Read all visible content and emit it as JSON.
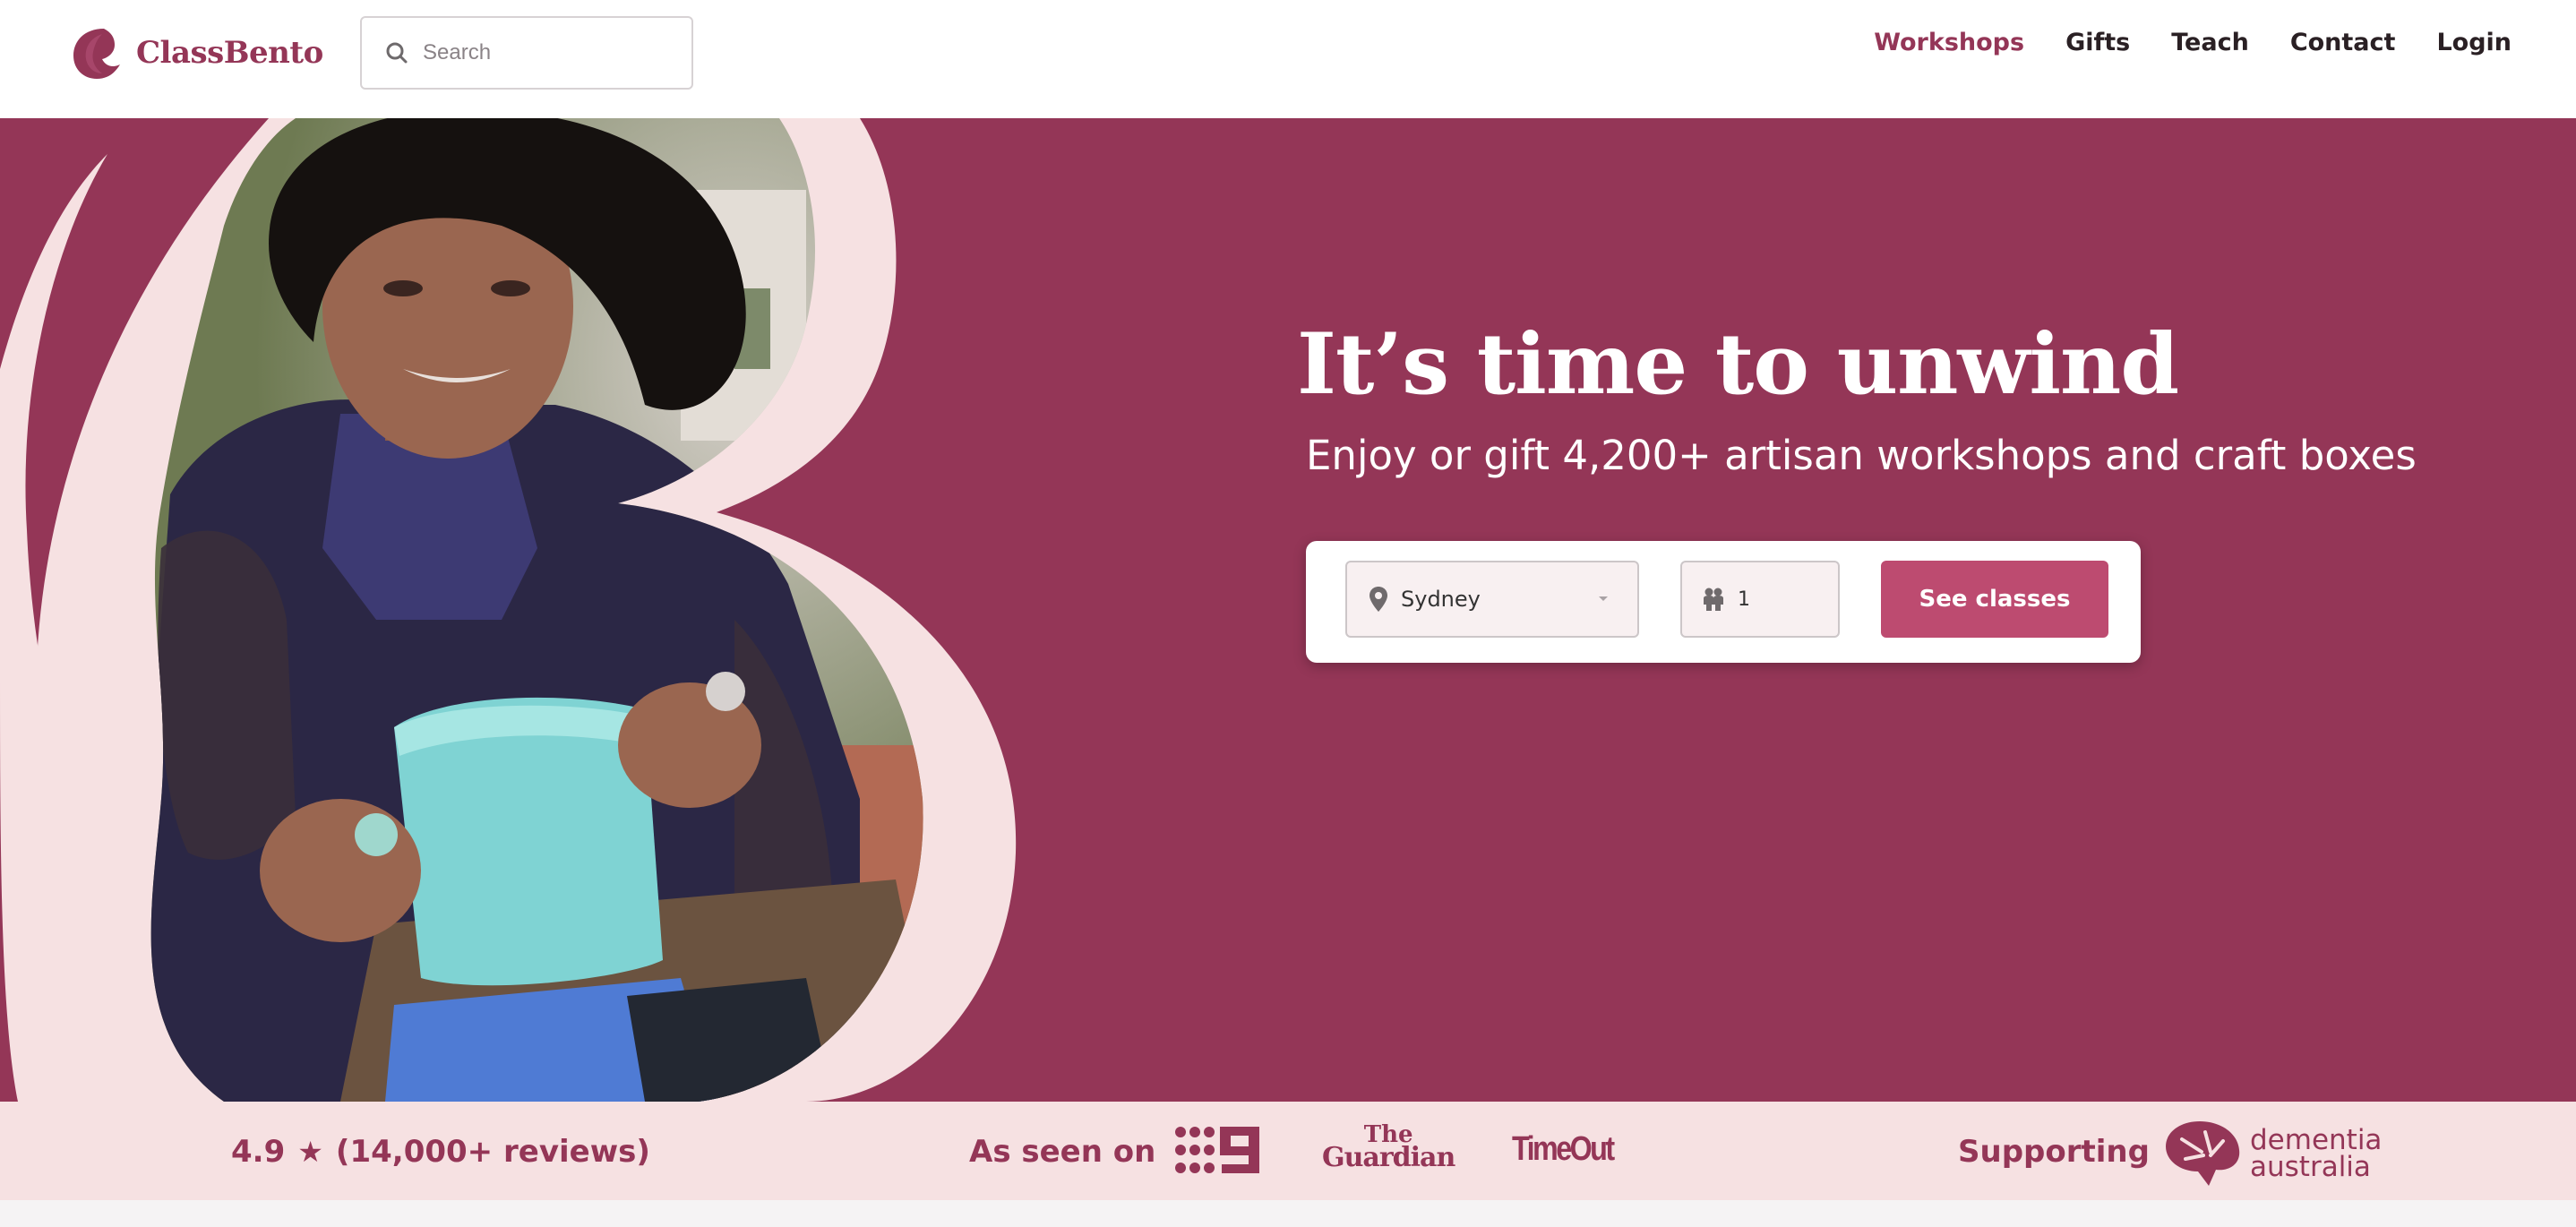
{
  "brand": {
    "name": "ClassBento",
    "color": "#943657"
  },
  "search": {
    "placeholder": "Search"
  },
  "nav": {
    "items": [
      {
        "label": "Workshops",
        "active": true
      },
      {
        "label": "Gifts",
        "active": false
      },
      {
        "label": "Teach",
        "active": false
      },
      {
        "label": "Contact",
        "active": false
      },
      {
        "label": "Login",
        "active": false
      }
    ]
  },
  "hero": {
    "title": "It’s time to unwind",
    "subtitle": "Enjoy or gift 4,200+ artisan workshops and craft boxes",
    "background": "#943657"
  },
  "booking": {
    "location": {
      "value": "Sydney",
      "icon": "location-pin-icon"
    },
    "people": {
      "value": "1",
      "icon": "people-icon"
    },
    "cta_label": "See classes",
    "cta_color": "#bd4b70"
  },
  "strip": {
    "rating_value": "4.9",
    "rating_reviews": "(14,000+ reviews)",
    "seen_on_label": "As seen on",
    "press": [
      "channel-nine-logo",
      "the-guardian-logo",
      "time-out-logo"
    ],
    "guardian_line1": "The",
    "guardian_line2": "Guardian",
    "timeout_text": "TimeOut",
    "supporting_label": "Supporting",
    "dementia_line1": "dementia",
    "dementia_line2": "australia"
  }
}
